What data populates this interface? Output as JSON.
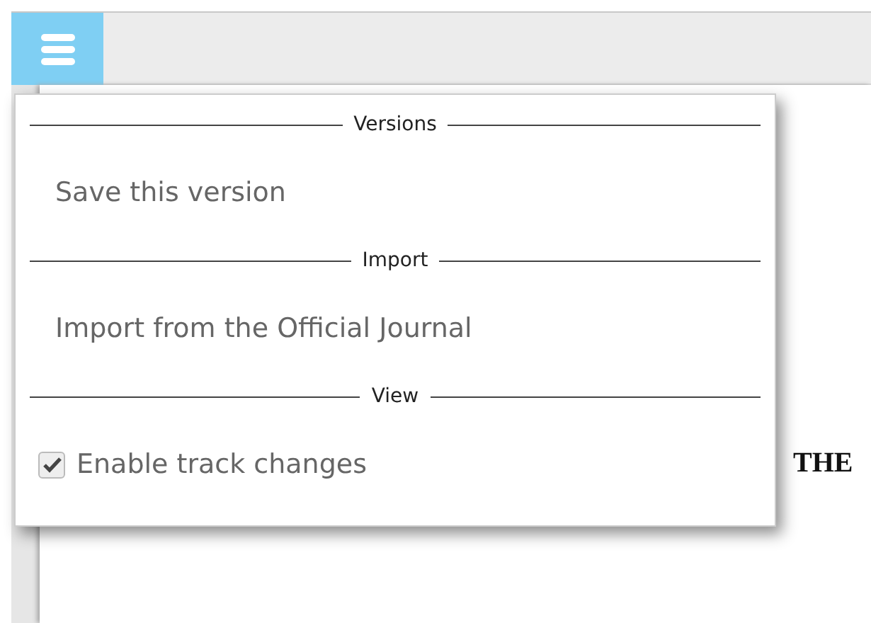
{
  "toolbar": {
    "menu_button": {
      "expanded": true
    }
  },
  "menu": {
    "sections": [
      {
        "header": "Versions",
        "items": [
          {
            "kind": "action",
            "label": "Save this version"
          }
        ]
      },
      {
        "header": "Import",
        "items": [
          {
            "kind": "action",
            "label": "Import from the Official Journal"
          }
        ]
      },
      {
        "header": "View",
        "items": [
          {
            "kind": "checkbox",
            "label": "Enable track changes",
            "checked": true
          }
        ]
      }
    ]
  },
  "document": {
    "text": "THE"
  }
}
